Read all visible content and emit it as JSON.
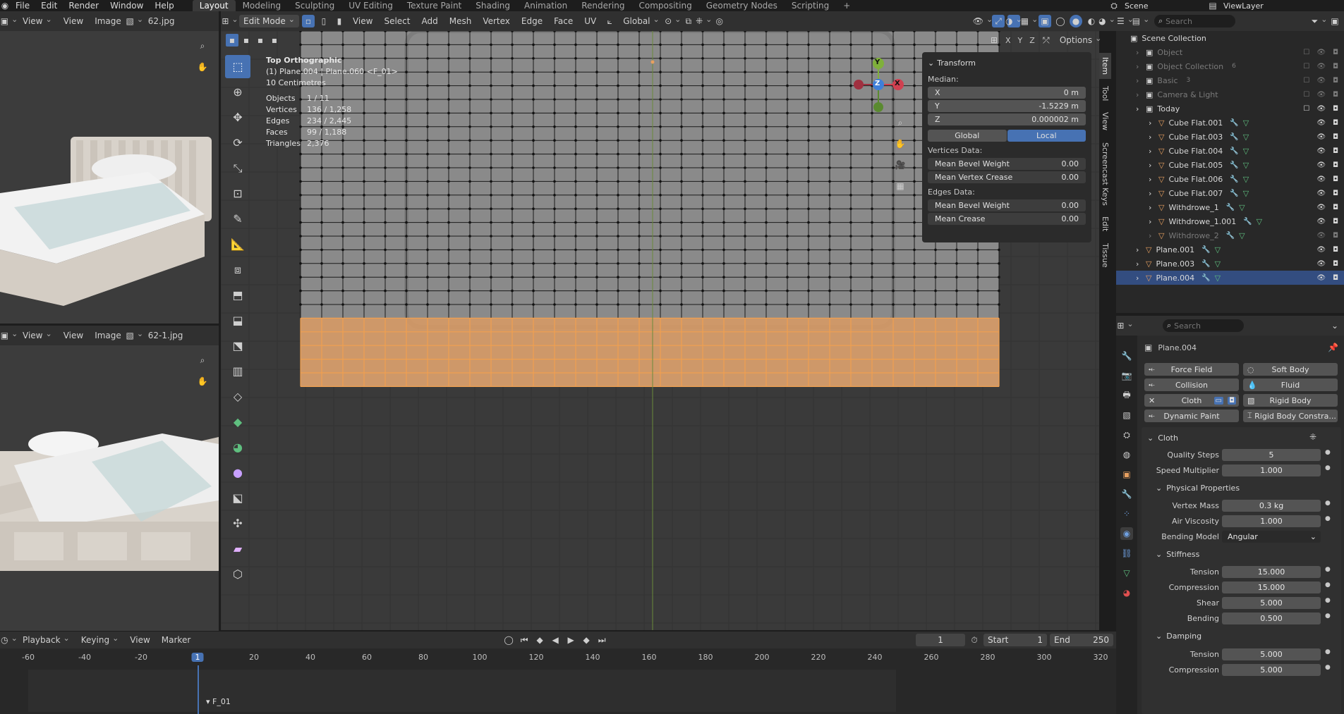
{
  "topbar": {
    "menus": [
      "File",
      "Edit",
      "Render",
      "Window",
      "Help"
    ],
    "workspaces": [
      "Layout",
      "Modeling",
      "Sculpting",
      "UV Editing",
      "Texture Paint",
      "Shading",
      "Animation",
      "Rendering",
      "Compositing",
      "Geometry Nodes",
      "Scripting"
    ],
    "active_workspace": "Layout",
    "add_tab": "+",
    "scene": "Scene",
    "view_layer": "ViewLayer"
  },
  "image_editor_top": {
    "menus": [
      "View",
      "View",
      "Image"
    ],
    "image_name": "62.jpg"
  },
  "image_editor_bottom": {
    "menus": [
      "View",
      "View",
      "Image"
    ],
    "image_name": "62-1.jpg"
  },
  "viewport_header": {
    "mode": "Edit Mode",
    "menus": [
      "View",
      "Select",
      "Add",
      "Mesh",
      "Vertex",
      "Edge",
      "Face",
      "UV"
    ],
    "orientation": "Global",
    "axes": [
      "X",
      "Y",
      "Z"
    ],
    "options": "Options"
  },
  "viewport_overlay": {
    "view_name": "Top Orthographic",
    "object_name": "(1) Plane.004 | Plane.060 <F_01>",
    "scale": "10 Centimetres",
    "stats": [
      {
        "label": "Objects",
        "value": "1 / 11"
      },
      {
        "label": "Vertices",
        "value": "136 / 1,258"
      },
      {
        "label": "Edges",
        "value": "234 / 2,445"
      },
      {
        "label": "Faces",
        "value": "99 / 1,188"
      },
      {
        "label": "Triangles",
        "value": "2,376"
      }
    ],
    "gizmo": {
      "y": "Y",
      "z": "Z",
      "x": "X"
    }
  },
  "side_tabs": [
    "Item",
    "Tool",
    "View",
    "Screencast Keys",
    "Edit",
    "Tissue"
  ],
  "transform_panel": {
    "title": "Transform",
    "median_label": "Median:",
    "x_label": "X",
    "x_value": "0 m",
    "y_label": "Y",
    "y_value": "-1.5229 m",
    "z_label": "Z",
    "z_value": "0.000002 m",
    "global": "Global",
    "local": "Local",
    "vertices_data": "Vertices Data:",
    "mean_bevel_weight": "Mean Bevel Weight",
    "mean_bevel_weight_value": "0.00",
    "mean_vertex_crease": "Mean Vertex Crease",
    "mean_vertex_crease_value": "0.00",
    "edges_data": "Edges Data:",
    "edge_mean_bevel_weight": "Mean Bevel Weight",
    "edge_mean_bevel_weight_value": "0.00",
    "mean_crease": "Mean Crease",
    "mean_crease_value": "0.00"
  },
  "outliner": {
    "search_placeholder": "Search",
    "root": "Scene Collection",
    "rows": [
      {
        "name": "Object",
        "indent": 1,
        "dim": true,
        "icon": "collection"
      },
      {
        "name": "Object Collection",
        "indent": 1,
        "dim": true,
        "icon": "collection",
        "badge": "6"
      },
      {
        "name": "Basic",
        "indent": 1,
        "dim": true,
        "icon": "collection",
        "badge": "3"
      },
      {
        "name": "Camera & Light",
        "indent": 1,
        "dim": true,
        "icon": "collection"
      },
      {
        "name": "Today",
        "indent": 1,
        "dim": false,
        "icon": "collection"
      },
      {
        "name": "Cube Flat.001",
        "indent": 2,
        "dim": false,
        "icon": "mesh"
      },
      {
        "name": "Cube Flat.003",
        "indent": 2,
        "dim": false,
        "icon": "mesh"
      },
      {
        "name": "Cube Flat.004",
        "indent": 2,
        "dim": false,
        "icon": "mesh"
      },
      {
        "name": "Cube Flat.005",
        "indent": 2,
        "dim": false,
        "icon": "mesh"
      },
      {
        "name": "Cube Flat.006",
        "indent": 2,
        "dim": false,
        "icon": "mesh"
      },
      {
        "name": "Cube Flat.007",
        "indent": 2,
        "dim": false,
        "icon": "mesh"
      },
      {
        "name": "Withdrowe_1",
        "indent": 2,
        "dim": false,
        "icon": "mesh"
      },
      {
        "name": "Withdrowe_1.001",
        "indent": 2,
        "dim": false,
        "icon": "mesh"
      },
      {
        "name": "Withdrowe_2",
        "indent": 2,
        "dim": true,
        "icon": "mesh"
      },
      {
        "name": "Plane.001",
        "indent": 1,
        "dim": false,
        "icon": "mesh"
      },
      {
        "name": "Plane.003",
        "indent": 1,
        "dim": false,
        "icon": "mesh"
      },
      {
        "name": "Plane.004",
        "indent": 1,
        "dim": false,
        "icon": "mesh",
        "selected": true
      }
    ]
  },
  "properties": {
    "search_placeholder": "Search",
    "object_name": "Plane.004",
    "physics_buttons": [
      "Force Field",
      "Soft Body",
      "Collision",
      "Fluid",
      "Cloth",
      "Rigid Body",
      "Dynamic Paint",
      "Rigid Body Constra..."
    ],
    "cloth_header": "Cloth",
    "quality_steps_label": "Quality Steps",
    "quality_steps": "5",
    "speed_multiplier_label": "Speed Multiplier",
    "speed_multiplier": "1.000",
    "physical_properties": "Physical Properties",
    "vertex_mass_label": "Vertex Mass",
    "vertex_mass": "0.3 kg",
    "air_viscosity_label": "Air Viscosity",
    "air_viscosity": "1.000",
    "bending_model_label": "Bending Model",
    "bending_model": "Angular",
    "stiffness": "Stiffness",
    "tension_label": "Tension",
    "tension": "15.000",
    "compression_label": "Compression",
    "compression": "15.000",
    "shear_label": "Shear",
    "shear": "5.000",
    "bending_label": "Bending",
    "bending": "0.500",
    "damping": "Damping",
    "d_tension_label": "Tension",
    "d_tension": "5.000",
    "d_compression_label": "Compression",
    "d_compression": "5.000"
  },
  "timeline": {
    "menus": [
      "Playback",
      "Keying",
      "View",
      "Marker"
    ],
    "current_frame": "1",
    "start_label": "Start",
    "start": "1",
    "end_label": "End",
    "end": "250",
    "ruler": [
      "-60",
      "-40",
      "-20",
      "1",
      "20",
      "40",
      "60",
      "80",
      "100",
      "120",
      "140",
      "160",
      "180",
      "200",
      "220",
      "240",
      "260",
      "280",
      "300",
      "320"
    ],
    "marker": "F_01"
  },
  "colors": {
    "accent": "#4772b3",
    "selection_orange": "#e8a060",
    "selected_row": "#334d80"
  }
}
